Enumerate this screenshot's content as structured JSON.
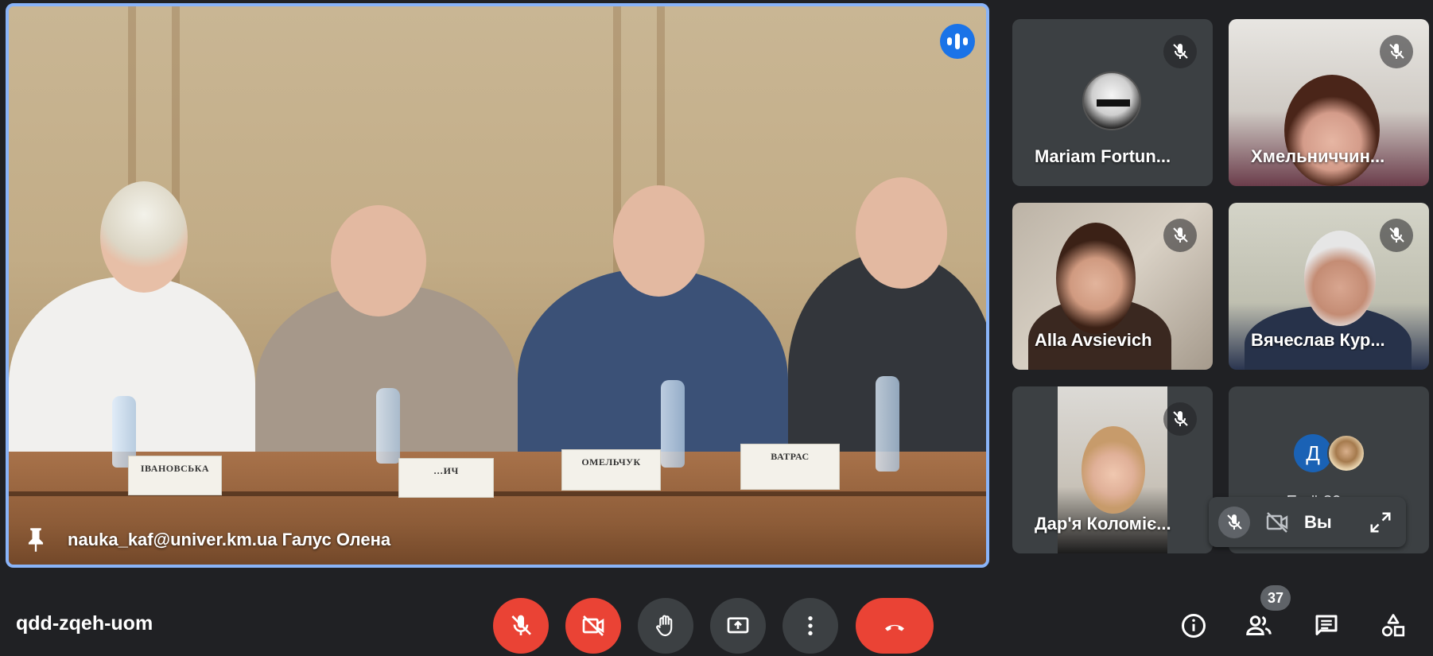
{
  "main_tile": {
    "name_label": "nauka_kaf@univer.km.ua Галус Олена",
    "speaking": true,
    "nameplates": [
      "ІВАНОВСЬКА",
      "…ИЧ",
      "ОМЕЛЬЧУК",
      "ВАТРАС"
    ]
  },
  "participants": [
    {
      "name": "Mariam Fortun...",
      "muted": true
    },
    {
      "name": "Хмельниччин...",
      "muted": true
    },
    {
      "name": "Alla Avsievich",
      "muted": true
    },
    {
      "name": "Вячеслав Кур...",
      "muted": true
    },
    {
      "name": "Дар'я Коломіє...",
      "muted": true
    }
  ],
  "more_tile": {
    "avatar_letter": "Д",
    "text": "Ещё 30 чел"
  },
  "self_view": {
    "label": "Вы"
  },
  "bottom_bar": {
    "meeting_code": "qdd-zqeh-uom",
    "participant_count": "37"
  },
  "colors": {
    "background": "#202124",
    "tile": "#3c4043",
    "danger": "#ea4335",
    "speaking_blue": "#1a73e8",
    "active_border": "#8ab4f8"
  },
  "icons": {
    "mic_off": "mic-off-icon",
    "cam_off": "camera-off-icon",
    "hand": "raise-hand-icon",
    "present": "present-screen-icon",
    "more": "more-vert-icon",
    "leave": "call-end-icon",
    "info": "info-icon",
    "people": "people-icon",
    "chat": "chat-icon",
    "activities": "activities-icon"
  }
}
